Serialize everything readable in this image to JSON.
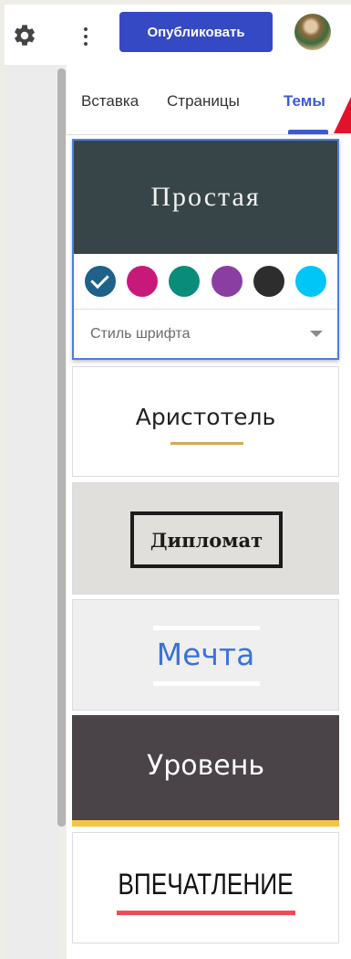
{
  "topbar": {
    "publish_label": "Опубликовать",
    "settings_icon": "gear-icon",
    "more_icon": "more-vert-icon",
    "avatar": "user-avatar"
  },
  "tabs": [
    {
      "label": "Вставка",
      "active": false
    },
    {
      "label": "Страницы",
      "active": false
    },
    {
      "label": "Темы",
      "active": true
    }
  ],
  "accent_color": "#3549c4",
  "themes": {
    "simple": {
      "name": "Простая",
      "selected": true,
      "colors": [
        "#1e6189",
        "#c8197a",
        "#0a8c7a",
        "#8b3ea1",
        "#2d2d2d",
        "#00c5f7"
      ],
      "selected_color_index": 0,
      "font_style_label": "Стиль шрифта"
    },
    "aristotle": {
      "name": "Аристотель"
    },
    "diplomat": {
      "name": "Дипломат"
    },
    "dream": {
      "name": "Мечта"
    },
    "level": {
      "name": "Уровень"
    },
    "impression": {
      "name": "ВПЕЧАТЛЕНИЕ"
    }
  }
}
